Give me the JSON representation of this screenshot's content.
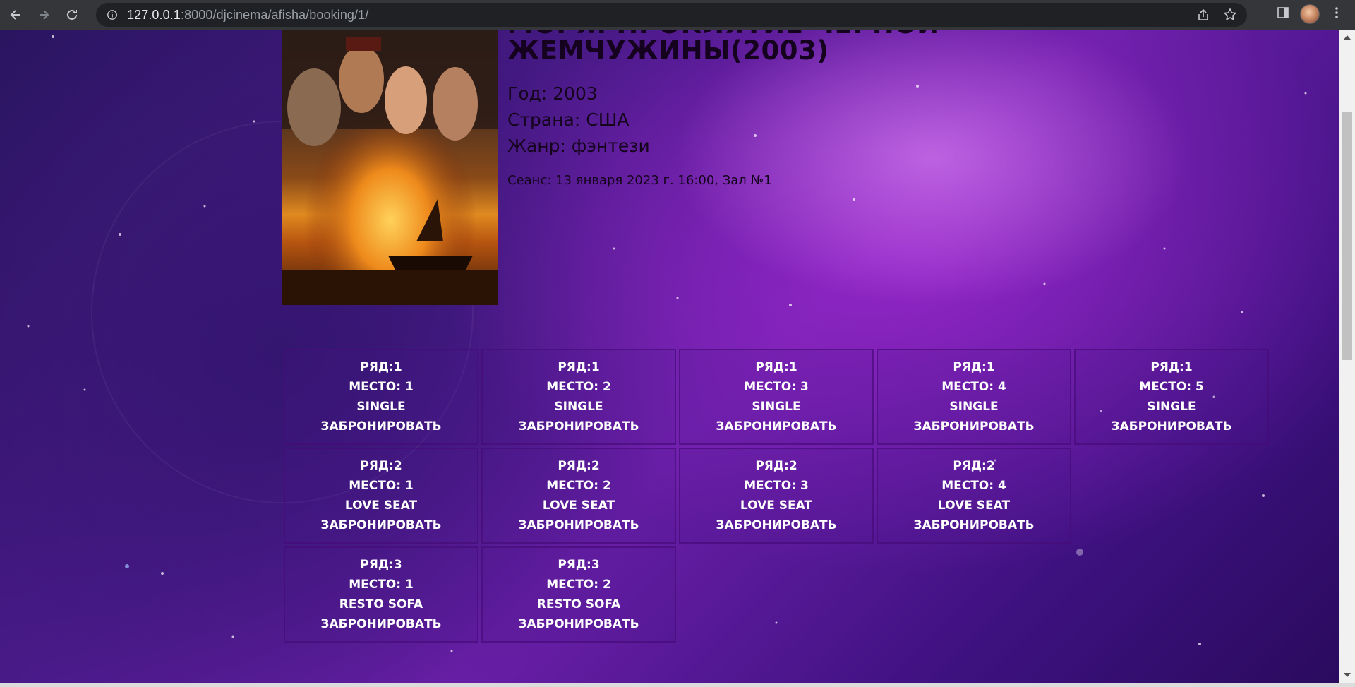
{
  "browser": {
    "url_host": "127.0.0.1",
    "url_rest": ":8000/djcinema/afisha/booking/1/"
  },
  "movie": {
    "title_line1": "МОРЯ: ПРОКЛЯТИЕ ЧЕРНОЙ",
    "title_line2": "ЖЕМЧУЖИНЫ(2003)",
    "year": "Год: 2003",
    "country": "Страна: США",
    "genre": "Жанр: фэнтези",
    "session": "Сеанс: 13 января 2023 г. 16:00, Зал №1"
  },
  "seats": [
    {
      "row": "РЯД:1",
      "place": "МЕСТО: 1",
      "type": "SINGLE",
      "action": "ЗАБРОНИРОВАТЬ"
    },
    {
      "row": "РЯД:1",
      "place": "МЕСТО: 2",
      "type": "SINGLE",
      "action": "ЗАБРОНИРОВАТЬ"
    },
    {
      "row": "РЯД:1",
      "place": "МЕСТО: 3",
      "type": "SINGLE",
      "action": "ЗАБРОНИРОВАТЬ"
    },
    {
      "row": "РЯД:1",
      "place": "МЕСТО: 4",
      "type": "SINGLE",
      "action": "ЗАБРОНИРОВАТЬ"
    },
    {
      "row": "РЯД:1",
      "place": "МЕСТО: 5",
      "type": "SINGLE",
      "action": "ЗАБРОНИРОВАТЬ"
    },
    {
      "row": "РЯД:2",
      "place": "МЕСТО: 1",
      "type": "LOVE SEAT",
      "action": "ЗАБРОНИРОВАТЬ"
    },
    {
      "row": "РЯД:2",
      "place": "МЕСТО: 2",
      "type": "LOVE SEAT",
      "action": "ЗАБРОНИРОВАТЬ"
    },
    {
      "row": "РЯД:2",
      "place": "МЕСТО: 3",
      "type": "LOVE SEAT",
      "action": "ЗАБРОНИРОВАТЬ"
    },
    {
      "row": "РЯД:2",
      "place": "МЕСТО: 4",
      "type": "LOVE SEAT",
      "action": "ЗАБРОНИРОВАТЬ"
    },
    {
      "row": "РЯД:3",
      "place": "МЕСТО: 1",
      "type": "RESTO SOFA",
      "action": "ЗАБРОНИРОВАТЬ"
    },
    {
      "row": "РЯД:3",
      "place": "МЕСТО: 2",
      "type": "RESTO SOFA",
      "action": "ЗАБРОНИРОВАТЬ"
    }
  ]
}
